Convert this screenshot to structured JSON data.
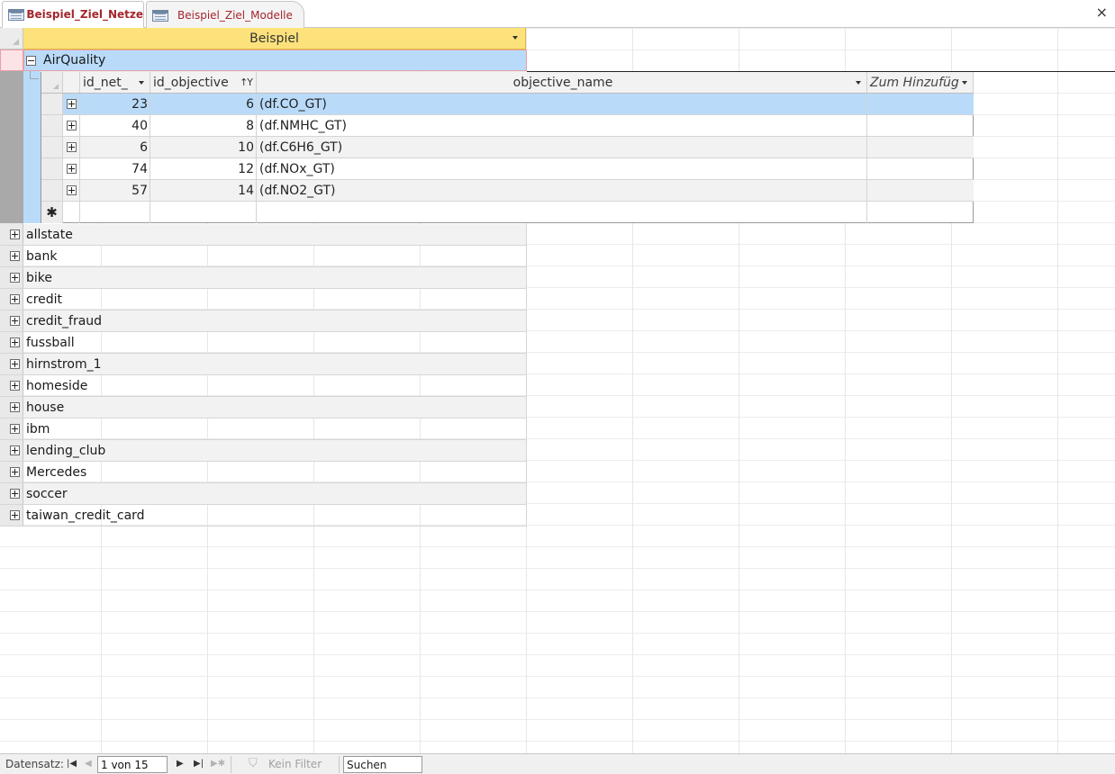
{
  "tabs": [
    {
      "label": "Beispiel_Ziel_Netze",
      "active": true
    },
    {
      "label": "Beispiel_Ziel_Modelle",
      "active": false
    }
  ],
  "colors": {
    "accent_text": "#a4262c",
    "header_selected": "#fde27c",
    "row_selected": "#b9dbf9"
  },
  "main_table": {
    "column_header": "Beispiel",
    "expanded_row": {
      "label": "AirQuality",
      "subtable": {
        "columns": [
          "id_net_",
          "id_objective",
          "objective_name",
          "Zum Hinzufüg"
        ],
        "rows": [
          {
            "id_net": "23",
            "id_objective": "6",
            "objective_name": "(df.CO_GT)"
          },
          {
            "id_net": "40",
            "id_objective": "8",
            "objective_name": "(df.NMHC_GT)"
          },
          {
            "id_net": "6",
            "id_objective": "10",
            "objective_name": "(df.C6H6_GT)"
          },
          {
            "id_net": "74",
            "id_objective": "12",
            "objective_name": "(df.NOx_GT)"
          },
          {
            "id_net": "57",
            "id_objective": "14",
            "objective_name": "(df.NO2_GT)"
          }
        ],
        "new_row_marker": "✱"
      }
    },
    "rows": [
      "allstate",
      "bank",
      "bike",
      "credit",
      "credit_fraud",
      "fussball",
      "hirnstrom_1",
      "homeside",
      "house",
      "ibm",
      "lending_club",
      "Mercedes",
      "soccer",
      "taiwan_credit_card"
    ]
  },
  "status_bar": {
    "record_label": "Datensatz:",
    "record_position": "1 von 15",
    "filter_label": "Kein Filter",
    "search_placeholder": "Suchen"
  },
  "icons": {
    "tab_icon": "form-icon",
    "close": "×",
    "filter": "filter-icon"
  }
}
